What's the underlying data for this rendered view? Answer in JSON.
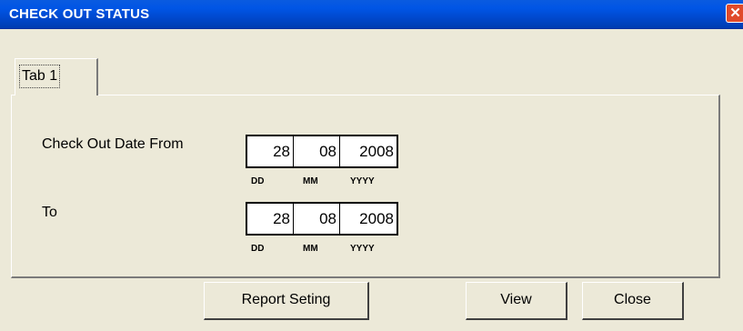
{
  "window": {
    "title": "CHECK OUT STATUS",
    "close_glyph": "✕"
  },
  "tabs": [
    {
      "label": "Tab 1"
    }
  ],
  "form": {
    "from_label": "Check Out Date From",
    "to_label": "To",
    "from": {
      "dd": "28",
      "mm": "08",
      "yyyy": "2008"
    },
    "to": {
      "dd": "28",
      "mm": "08",
      "yyyy": "2008"
    },
    "sub_dd": "DD",
    "sub_mm": "MM",
    "sub_yyyy": "YYYY"
  },
  "buttons": {
    "report": "Report Seting",
    "view": "View",
    "close": "Close"
  },
  "icons": {
    "close": "close-icon"
  },
  "colors": {
    "titlebar": "#0055e5",
    "close_button": "#e04a2a",
    "background": "#ece9d8"
  }
}
